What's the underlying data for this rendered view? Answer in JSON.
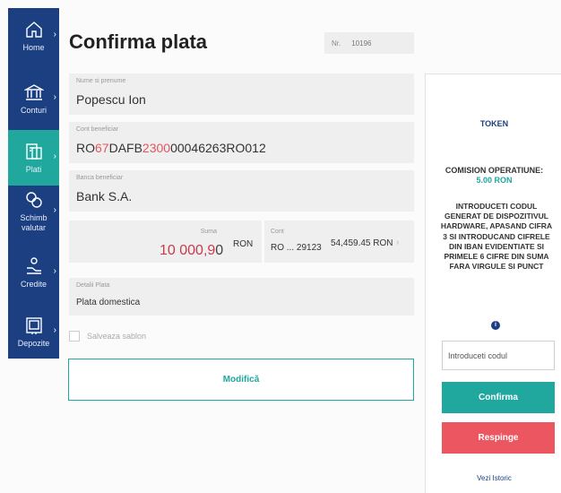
{
  "sidebar": {
    "items": [
      {
        "label": "Home",
        "icon": "home-icon",
        "active": false
      },
      {
        "label": "Conturi",
        "icon": "bank-icon",
        "active": false
      },
      {
        "label": "Plati",
        "icon": "payment-icon",
        "active": true
      },
      {
        "label": "Schimb valutar",
        "icon": "exchange-icon",
        "active": false
      },
      {
        "label": "Credite",
        "icon": "credit-icon",
        "active": false
      },
      {
        "label": "Depozite",
        "icon": "deposit-icon",
        "active": false
      }
    ]
  },
  "main": {
    "title": "Confirma plata",
    "nr_label": "Nr.",
    "nr_value": "10196",
    "payee": {
      "label": "Nume si prenume",
      "value": "Popescu Ion"
    },
    "iban": {
      "label": "Cont beneficiar",
      "part1": "RO",
      "part2": "67",
      "part3": "DAFB",
      "part4": "2300",
      "part5": "00046263RO012"
    },
    "bank": {
      "label": "Banca beneficiar",
      "value": "Bank S.A."
    },
    "sum": {
      "label": "Suma",
      "amount_main": "10 000,9",
      "amount_last": "0",
      "currency": "RON"
    },
    "account": {
      "label": "Cont",
      "value": "RO ... 29123",
      "balance": "54,459.45 RON"
    },
    "details": {
      "label": "Detalii Plata",
      "value": "Plata domestica"
    },
    "save_template": "Salveaza sablon",
    "modify_button": "Modifică"
  },
  "panel": {
    "token": "TOKEN",
    "comision_label": "COMISION OPERATIUNE:",
    "comision_value": "5.00 RON",
    "instructions": "INTRODUCETI CODUL GENERAT DE DISPOZITIVUL HARDWARE, APASAND CIFRA 3 SI INTRODUCAND CIFRELE DIN IBAN EVIDENTIATE SI PRIMELE 6 CIFRE DIN SUMA FARA VIRGULE SI PUNCT",
    "info_icon": "i",
    "code_placeholder": "Introduceti codul",
    "confirm_button": "Confirma",
    "reject_button": "Respinge",
    "history_link": "Vezi Istoric"
  },
  "colors": {
    "sidebar": "#1c3f82",
    "accent": "#20a79e",
    "reject": "#ec5661",
    "highlight": "#e2555f"
  }
}
